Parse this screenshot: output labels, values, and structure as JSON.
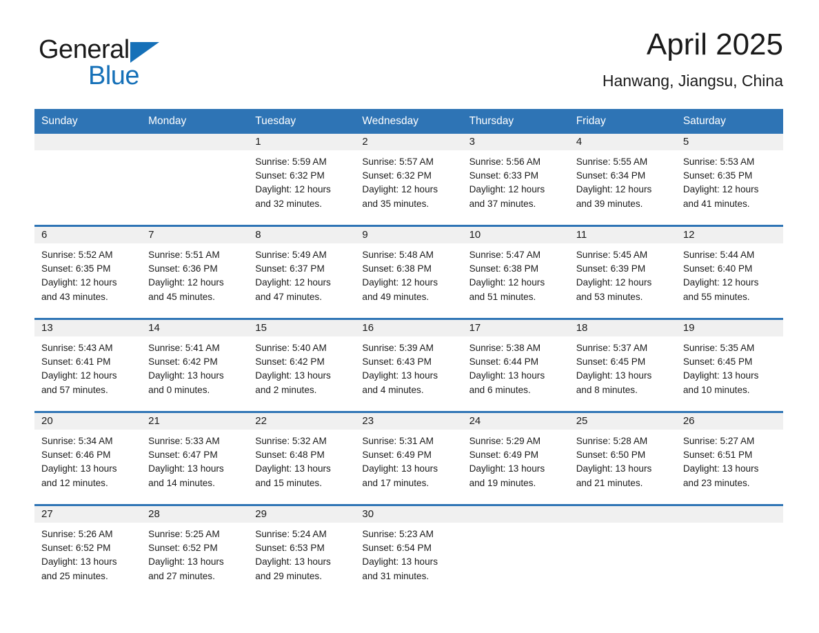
{
  "brand": {
    "name_part1": "General",
    "name_part2": "Blue",
    "triangle_color": "#1570b8",
    "blue_text_color": "#1570b8"
  },
  "header": {
    "title": "April 2025",
    "location": "Hanwang, Jiangsu, China"
  },
  "theme": {
    "header_blue": "#2e74b5",
    "day_band_gray": "#f0f0f0",
    "text_color": "#1a1a1a",
    "page_background": "#ffffff"
  },
  "weekdays": [
    "Sunday",
    "Monday",
    "Tuesday",
    "Wednesday",
    "Thursday",
    "Friday",
    "Saturday"
  ],
  "weeks": [
    [
      {
        "day": "",
        "empty": true
      },
      {
        "day": "",
        "empty": true
      },
      {
        "day": "1",
        "sunrise": "Sunrise: 5:59 AM",
        "sunset": "Sunset: 6:32 PM",
        "daylight_line1": "Daylight: 12 hours",
        "daylight_line2": "and 32 minutes."
      },
      {
        "day": "2",
        "sunrise": "Sunrise: 5:57 AM",
        "sunset": "Sunset: 6:32 PM",
        "daylight_line1": "Daylight: 12 hours",
        "daylight_line2": "and 35 minutes."
      },
      {
        "day": "3",
        "sunrise": "Sunrise: 5:56 AM",
        "sunset": "Sunset: 6:33 PM",
        "daylight_line1": "Daylight: 12 hours",
        "daylight_line2": "and 37 minutes."
      },
      {
        "day": "4",
        "sunrise": "Sunrise: 5:55 AM",
        "sunset": "Sunset: 6:34 PM",
        "daylight_line1": "Daylight: 12 hours",
        "daylight_line2": "and 39 minutes."
      },
      {
        "day": "5",
        "sunrise": "Sunrise: 5:53 AM",
        "sunset": "Sunset: 6:35 PM",
        "daylight_line1": "Daylight: 12 hours",
        "daylight_line2": "and 41 minutes."
      }
    ],
    [
      {
        "day": "6",
        "sunrise": "Sunrise: 5:52 AM",
        "sunset": "Sunset: 6:35 PM",
        "daylight_line1": "Daylight: 12 hours",
        "daylight_line2": "and 43 minutes."
      },
      {
        "day": "7",
        "sunrise": "Sunrise: 5:51 AM",
        "sunset": "Sunset: 6:36 PM",
        "daylight_line1": "Daylight: 12 hours",
        "daylight_line2": "and 45 minutes."
      },
      {
        "day": "8",
        "sunrise": "Sunrise: 5:49 AM",
        "sunset": "Sunset: 6:37 PM",
        "daylight_line1": "Daylight: 12 hours",
        "daylight_line2": "and 47 minutes."
      },
      {
        "day": "9",
        "sunrise": "Sunrise: 5:48 AM",
        "sunset": "Sunset: 6:38 PM",
        "daylight_line1": "Daylight: 12 hours",
        "daylight_line2": "and 49 minutes."
      },
      {
        "day": "10",
        "sunrise": "Sunrise: 5:47 AM",
        "sunset": "Sunset: 6:38 PM",
        "daylight_line1": "Daylight: 12 hours",
        "daylight_line2": "and 51 minutes."
      },
      {
        "day": "11",
        "sunrise": "Sunrise: 5:45 AM",
        "sunset": "Sunset: 6:39 PM",
        "daylight_line1": "Daylight: 12 hours",
        "daylight_line2": "and 53 minutes."
      },
      {
        "day": "12",
        "sunrise": "Sunrise: 5:44 AM",
        "sunset": "Sunset: 6:40 PM",
        "daylight_line1": "Daylight: 12 hours",
        "daylight_line2": "and 55 minutes."
      }
    ],
    [
      {
        "day": "13",
        "sunrise": "Sunrise: 5:43 AM",
        "sunset": "Sunset: 6:41 PM",
        "daylight_line1": "Daylight: 12 hours",
        "daylight_line2": "and 57 minutes."
      },
      {
        "day": "14",
        "sunrise": "Sunrise: 5:41 AM",
        "sunset": "Sunset: 6:42 PM",
        "daylight_line1": "Daylight: 13 hours",
        "daylight_line2": "and 0 minutes."
      },
      {
        "day": "15",
        "sunrise": "Sunrise: 5:40 AM",
        "sunset": "Sunset: 6:42 PM",
        "daylight_line1": "Daylight: 13 hours",
        "daylight_line2": "and 2 minutes."
      },
      {
        "day": "16",
        "sunrise": "Sunrise: 5:39 AM",
        "sunset": "Sunset: 6:43 PM",
        "daylight_line1": "Daylight: 13 hours",
        "daylight_line2": "and 4 minutes."
      },
      {
        "day": "17",
        "sunrise": "Sunrise: 5:38 AM",
        "sunset": "Sunset: 6:44 PM",
        "daylight_line1": "Daylight: 13 hours",
        "daylight_line2": "and 6 minutes."
      },
      {
        "day": "18",
        "sunrise": "Sunrise: 5:37 AM",
        "sunset": "Sunset: 6:45 PM",
        "daylight_line1": "Daylight: 13 hours",
        "daylight_line2": "and 8 minutes."
      },
      {
        "day": "19",
        "sunrise": "Sunrise: 5:35 AM",
        "sunset": "Sunset: 6:45 PM",
        "daylight_line1": "Daylight: 13 hours",
        "daylight_line2": "and 10 minutes."
      }
    ],
    [
      {
        "day": "20",
        "sunrise": "Sunrise: 5:34 AM",
        "sunset": "Sunset: 6:46 PM",
        "daylight_line1": "Daylight: 13 hours",
        "daylight_line2": "and 12 minutes."
      },
      {
        "day": "21",
        "sunrise": "Sunrise: 5:33 AM",
        "sunset": "Sunset: 6:47 PM",
        "daylight_line1": "Daylight: 13 hours",
        "daylight_line2": "and 14 minutes."
      },
      {
        "day": "22",
        "sunrise": "Sunrise: 5:32 AM",
        "sunset": "Sunset: 6:48 PM",
        "daylight_line1": "Daylight: 13 hours",
        "daylight_line2": "and 15 minutes."
      },
      {
        "day": "23",
        "sunrise": "Sunrise: 5:31 AM",
        "sunset": "Sunset: 6:49 PM",
        "daylight_line1": "Daylight: 13 hours",
        "daylight_line2": "and 17 minutes."
      },
      {
        "day": "24",
        "sunrise": "Sunrise: 5:29 AM",
        "sunset": "Sunset: 6:49 PM",
        "daylight_line1": "Daylight: 13 hours",
        "daylight_line2": "and 19 minutes."
      },
      {
        "day": "25",
        "sunrise": "Sunrise: 5:28 AM",
        "sunset": "Sunset: 6:50 PM",
        "daylight_line1": "Daylight: 13 hours",
        "daylight_line2": "and 21 minutes."
      },
      {
        "day": "26",
        "sunrise": "Sunrise: 5:27 AM",
        "sunset": "Sunset: 6:51 PM",
        "daylight_line1": "Daylight: 13 hours",
        "daylight_line2": "and 23 minutes."
      }
    ],
    [
      {
        "day": "27",
        "sunrise": "Sunrise: 5:26 AM",
        "sunset": "Sunset: 6:52 PM",
        "daylight_line1": "Daylight: 13 hours",
        "daylight_line2": "and 25 minutes."
      },
      {
        "day": "28",
        "sunrise": "Sunrise: 5:25 AM",
        "sunset": "Sunset: 6:52 PM",
        "daylight_line1": "Daylight: 13 hours",
        "daylight_line2": "and 27 minutes."
      },
      {
        "day": "29",
        "sunrise": "Sunrise: 5:24 AM",
        "sunset": "Sunset: 6:53 PM",
        "daylight_line1": "Daylight: 13 hours",
        "daylight_line2": "and 29 minutes."
      },
      {
        "day": "30",
        "sunrise": "Sunrise: 5:23 AM",
        "sunset": "Sunset: 6:54 PM",
        "daylight_line1": "Daylight: 13 hours",
        "daylight_line2": "and 31 minutes."
      },
      {
        "day": "",
        "empty": true
      },
      {
        "day": "",
        "empty": true
      },
      {
        "day": "",
        "empty": true
      }
    ]
  ]
}
